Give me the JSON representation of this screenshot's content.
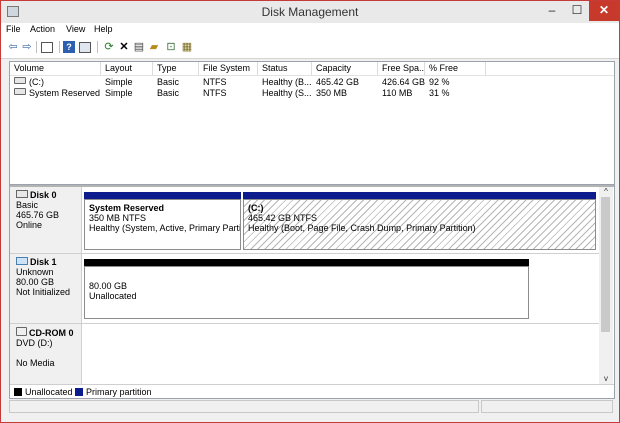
{
  "window": {
    "title": "Disk Management",
    "minimize": "–",
    "maximize": "☐",
    "close": "✕"
  },
  "menu": [
    "File",
    "Action",
    "View",
    "Help"
  ],
  "volumes": {
    "headers": [
      "Volume",
      "Layout",
      "Type",
      "File System",
      "Status",
      "Capacity",
      "Free Spa...",
      "% Free"
    ],
    "rows": [
      [
        "(C:)",
        "Simple",
        "Basic",
        "NTFS",
        "Healthy (B...",
        "465.42 GB",
        "426.64 GB",
        "92 %"
      ],
      [
        "System Reserved",
        "Simple",
        "Basic",
        "NTFS",
        "Healthy (S...",
        "350 MB",
        "110 MB",
        "31 %"
      ]
    ]
  },
  "disks": [
    {
      "name": "Disk 0",
      "lines": [
        "Basic",
        "465.76 GB",
        "Online"
      ],
      "partitions": [
        {
          "title": "System Reserved",
          "size": "350 MB NTFS",
          "status": "Healthy (System, Active, Primary Partitio"
        },
        {
          "title": "(C:)",
          "size": "465.42 GB NTFS",
          "status": "Healthy (Boot, Page File, Crash Dump, Primary Partition)"
        }
      ]
    },
    {
      "name": "Disk 1",
      "lines": [
        "Unknown",
        "80.00 GB",
        "Not Initialized"
      ],
      "partitions": [
        {
          "size": "80.00 GB",
          "status": "Unallocated"
        }
      ]
    },
    {
      "name": "CD-ROM 0",
      "lines": [
        "DVD (D:)",
        "",
        "No Media"
      ]
    }
  ],
  "legend": [
    {
      "label": "Unallocated",
      "color": "#000000"
    },
    {
      "label": "Primary partition",
      "color": "#0c1c8c"
    }
  ],
  "scroll": {
    "up": "^",
    "down": "v"
  },
  "colors": {
    "accent_close": "#c7392b",
    "primary_partition": "#0c1c8c",
    "unallocated": "#000000"
  }
}
